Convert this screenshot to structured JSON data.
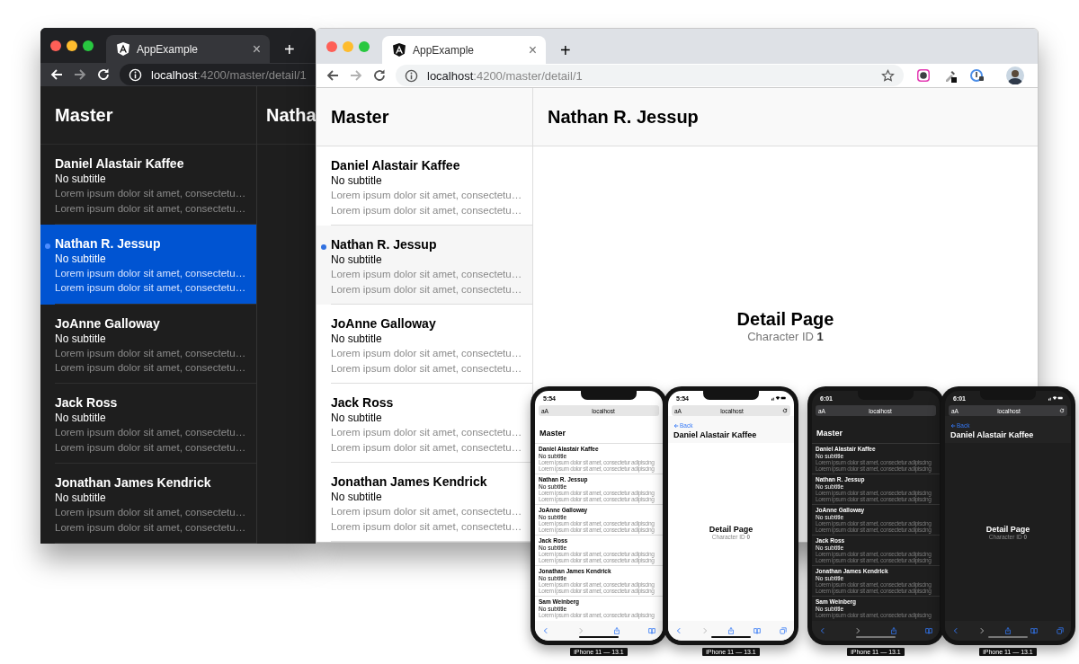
{
  "browsers": [
    {
      "kind": "dark",
      "tab_title": "AppExample",
      "tab_close": "×",
      "new_tab": "+",
      "url_host": "localhost",
      "url_path": ":4200/master/detail/1",
      "master_title": "Master",
      "detail_title": "Natha",
      "items": [
        {
          "name": "Daniel Alastair Kaffee",
          "subtitle": "No subtitle",
          "lines": [
            "Lorem ipsum dolor sit amet, consectetu…",
            "Lorem ipsum dolor sit amet, consectetu…"
          ],
          "selected": false
        },
        {
          "name": "Nathan R. Jessup",
          "subtitle": "No subtitle",
          "lines": [
            "Lorem ipsum dolor sit amet, consectetu…",
            "Lorem ipsum dolor sit amet, consectetu…"
          ],
          "selected": true
        },
        {
          "name": "JoAnne Galloway",
          "subtitle": "No subtitle",
          "lines": [
            "Lorem ipsum dolor sit amet, consectetu…",
            "Lorem ipsum dolor sit amet, consectetu…"
          ],
          "selected": false
        },
        {
          "name": "Jack Ross",
          "subtitle": "No subtitle",
          "lines": [
            "Lorem ipsum dolor sit amet, consectetu…",
            "Lorem ipsum dolor sit amet, consectetu…"
          ],
          "selected": false
        },
        {
          "name": "Jonathan James Kendrick",
          "subtitle": "No subtitle",
          "lines": [
            "Lorem ipsum dolor sit amet, consectetu…",
            "Lorem ipsum dolor sit amet, consectetu…"
          ],
          "selected": false
        }
      ]
    },
    {
      "kind": "light",
      "tab_title": "AppExample",
      "tab_close": "×",
      "new_tab": "+",
      "url_host": "localhost",
      "url_path": ":4200/master/detail/1",
      "master_title": "Master",
      "detail_title": "Nathan R. Jessup",
      "detail": {
        "heading": "Detail Page",
        "caption": "Character ID **1**"
      },
      "items": [
        {
          "name": "Daniel Alastair Kaffee",
          "subtitle": "No subtitle",
          "lines": [
            "Lorem ipsum dolor sit amet, consectetu…",
            "Lorem ipsum dolor sit amet, consectetu…"
          ],
          "selected": false
        },
        {
          "name": "Nathan R. Jessup",
          "subtitle": "No subtitle",
          "lines": [
            "Lorem ipsum dolor sit amet, consectetu…",
            "Lorem ipsum dolor sit amet, consectetu…"
          ],
          "selected": true
        },
        {
          "name": "JoAnne Galloway",
          "subtitle": "No subtitle",
          "lines": [
            "Lorem ipsum dolor sit amet, consectetu…",
            "Lorem ipsum dolor sit amet, consectetu…"
          ],
          "selected": false
        },
        {
          "name": "Jack Ross",
          "subtitle": "No subtitle",
          "lines": [
            "Lorem ipsum dolor sit amet, consectetu…",
            "Lorem ipsum dolor sit amet, consectetu…"
          ],
          "selected": false
        },
        {
          "name": "Jonathan James Kendrick",
          "subtitle": "No subtitle",
          "lines": [
            "Lorem ipsum dolor sit amet, consectetu…",
            "Lorem ipsum dolor sit amet, consectetu…"
          ],
          "selected": false
        }
      ]
    }
  ],
  "phones": [
    {
      "kind": "light",
      "time": "5:54",
      "reader": "aA",
      "address": "localhost",
      "title": "Master",
      "device_label": "iPhone 11 — 13.1",
      "items": [
        {
          "name": "Daniel Alastair Kaffee",
          "subtitle": "No subtitle",
          "lines": [
            "Lorem ipsum dolor sit amet, consectetur adipiscing",
            "Lorem ipsum dolor sit amet, consectetur adipiscing"
          ]
        },
        {
          "name": "Nathan R. Jessup",
          "subtitle": "No subtitle",
          "lines": [
            "Lorem ipsum dolor sit amet, consectetur adipiscing",
            "Lorem ipsum dolor sit amet, consectetur adipiscing"
          ]
        },
        {
          "name": "JoAnne Galloway",
          "subtitle": "No subtitle",
          "lines": [
            "Lorem ipsum dolor sit amet, consectetur adipiscing",
            "Lorem ipsum dolor sit amet, consectetur adipiscing"
          ]
        },
        {
          "name": "Jack Ross",
          "subtitle": "No subtitle",
          "lines": [
            "Lorem ipsum dolor sit amet, consectetur adipiscing",
            "Lorem ipsum dolor sit amet, consectetur adipiscing"
          ]
        },
        {
          "name": "Jonathan James Kendrick",
          "subtitle": "No subtitle",
          "lines": [
            "Lorem ipsum dolor sit amet, consectetur adipiscing",
            "Lorem ipsum dolor sit amet, consectetur adipiscing"
          ]
        },
        {
          "name": "Sam Weinberg",
          "subtitle": "No subtitle",
          "lines": [
            "Lorem ipsum dolor sit amet, consectetur adipiscing"
          ]
        }
      ]
    },
    {
      "kind": "light",
      "time": "5:54",
      "reader": "aA",
      "address": "localhost",
      "back": "Back",
      "title": "Daniel Alastair Kaffee",
      "heading": "Detail Page",
      "caption": "Character ID **0**",
      "device_label": "iPhone 11 — 13.1"
    },
    {
      "kind": "dark",
      "time": "6:01",
      "reader": "aA",
      "address": "localhost",
      "title": "Master",
      "device_label": "iPhone 11 — 13.1",
      "items": [
        {
          "name": "Daniel Alastair Kaffee",
          "subtitle": "No subtitle",
          "lines": [
            "Lorem ipsum dolor sit amet, consectetur adipiscing",
            "Lorem ipsum dolor sit amet, consectetur adipiscing"
          ]
        },
        {
          "name": "Nathan R. Jessup",
          "subtitle": "No subtitle",
          "lines": [
            "Lorem ipsum dolor sit amet, consectetur adipiscing",
            "Lorem ipsum dolor sit amet, consectetur adipiscing"
          ]
        },
        {
          "name": "JoAnne Galloway",
          "subtitle": "No subtitle",
          "lines": [
            "Lorem ipsum dolor sit amet, consectetur adipiscing",
            "Lorem ipsum dolor sit amet, consectetur adipiscing"
          ]
        },
        {
          "name": "Jack Ross",
          "subtitle": "No subtitle",
          "lines": [
            "Lorem ipsum dolor sit amet, consectetur adipiscing",
            "Lorem ipsum dolor sit amet, consectetur adipiscing"
          ]
        },
        {
          "name": "Jonathan James Kendrick",
          "subtitle": "No subtitle",
          "lines": [
            "Lorem ipsum dolor sit amet, consectetur adipiscing",
            "Lorem ipsum dolor sit amet, consectetur adipiscing"
          ]
        },
        {
          "name": "Sam Weinberg",
          "subtitle": "No subtitle",
          "lines": [
            "Lorem ipsum dolor sit amet, consectetur adipiscing"
          ]
        }
      ]
    },
    {
      "kind": "dark",
      "time": "6:01",
      "reader": "aA",
      "address": "localhost",
      "back": "Back",
      "title": "Daniel Alastair Kaffee",
      "heading": "Detail Page",
      "caption": "Character ID **0**",
      "device_label": "iPhone 11 — 13.1"
    }
  ]
}
